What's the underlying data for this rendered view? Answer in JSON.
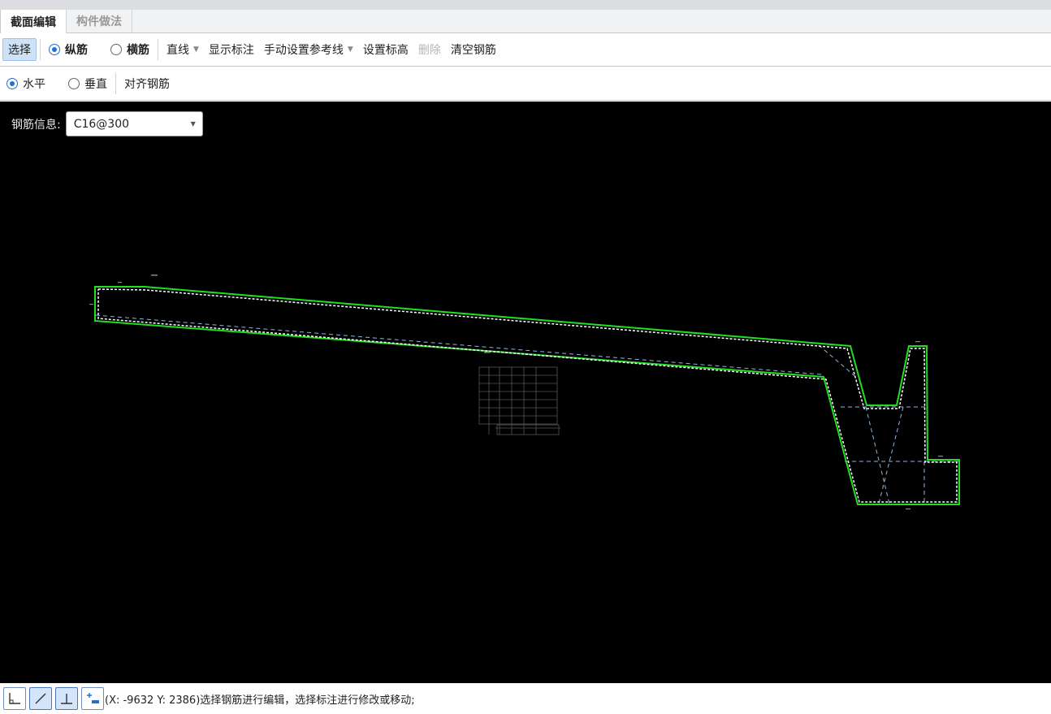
{
  "tabs": [
    {
      "label": "截面编辑",
      "active": true
    },
    {
      "label": "构件做法",
      "active": false
    }
  ],
  "toolbar": {
    "select_label": "选择",
    "longitudinal_label": "纵筋",
    "transverse_label": "横筋",
    "line_mode_label": "直线",
    "show_dimensions_label": "显示标注",
    "manual_ref_line_label": "手动设置参考线",
    "set_elevation_label": "设置标高",
    "delete_label": "删除",
    "clear_rebar_label": "清空钢筋"
  },
  "toolbar2": {
    "horizontal_label": "水平",
    "vertical_label": "垂直",
    "align_rebar_label": "对齐钢筋"
  },
  "rebar_info": {
    "label": "钢筋信息:",
    "value": "C16@300"
  },
  "status": {
    "coords_text": "(X: -9632 Y: 2386)选择钢筋进行编辑，选择标注进行修改或移动;"
  },
  "icons": {
    "snap_buttons": [
      "orthogonal-icon",
      "line-angle-icon",
      "perpendicular-icon",
      "add-point-icon"
    ]
  },
  "colors": {
    "canvas_bg": "#000000",
    "outline": "#22dd22",
    "rebar": "#ffffff",
    "reference": "#8fb4e8",
    "accent": "#1f6fd6"
  }
}
